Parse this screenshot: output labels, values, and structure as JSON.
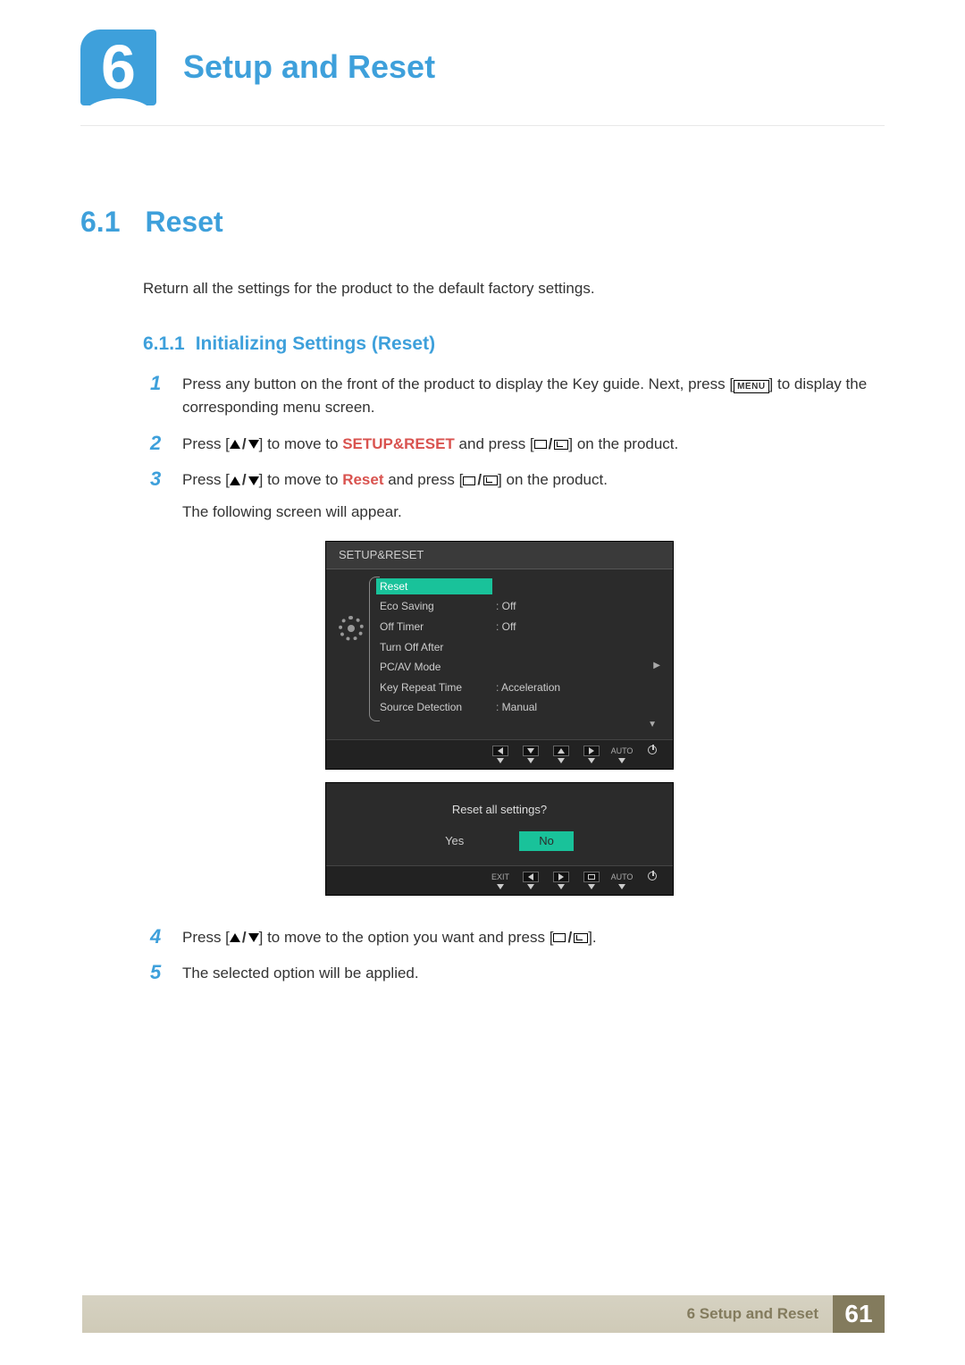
{
  "chapter": {
    "number": "6",
    "title": "Setup and Reset"
  },
  "section": {
    "number": "6.1",
    "title": "Reset"
  },
  "intro": "Return all the settings for the product to the default factory settings.",
  "subsection": {
    "number": "6.1.1",
    "title": "Initializing Settings (Reset)"
  },
  "steps": {
    "s1a": "Press any button on the front of the product to display the Key guide. Next, press [",
    "s1menu": "MENU",
    "s1b": "] to display the corresponding menu screen.",
    "s2a": "Press [",
    "s2b": "] to move to ",
    "s2link": "SETUP&RESET",
    "s2c": " and press [",
    "s2d": "] on the product.",
    "s3a": "Press [",
    "s3b": "] to move to ",
    "s3link": "Reset",
    "s3c": " and press [",
    "s3d": "] on the product.",
    "s3note": "The following screen will appear.",
    "s4a": "Press [",
    "s4b": "] to move to the option you want and press [",
    "s4c": "].",
    "s5": "The selected option will be applied."
  },
  "osd1": {
    "title": "SETUP&RESET",
    "rows": [
      {
        "k": "Reset",
        "v": "",
        "hl": true
      },
      {
        "k": "Eco Saving",
        "v": "Off"
      },
      {
        "k": "Off Timer",
        "v": "Off"
      },
      {
        "k": "Turn Off After",
        "v": ""
      },
      {
        "k": "PC/AV Mode",
        "v": ""
      },
      {
        "k": "Key Repeat Time",
        "v": "Acceleration"
      },
      {
        "k": "Source Detection",
        "v": "Manual"
      }
    ],
    "footer_auto": "AUTO"
  },
  "osd2": {
    "question": "Reset all settings?",
    "yes": "Yes",
    "no": "No",
    "exit": "EXIT",
    "auto": "AUTO"
  },
  "footer": {
    "label": "6 Setup and Reset",
    "page": "61"
  }
}
